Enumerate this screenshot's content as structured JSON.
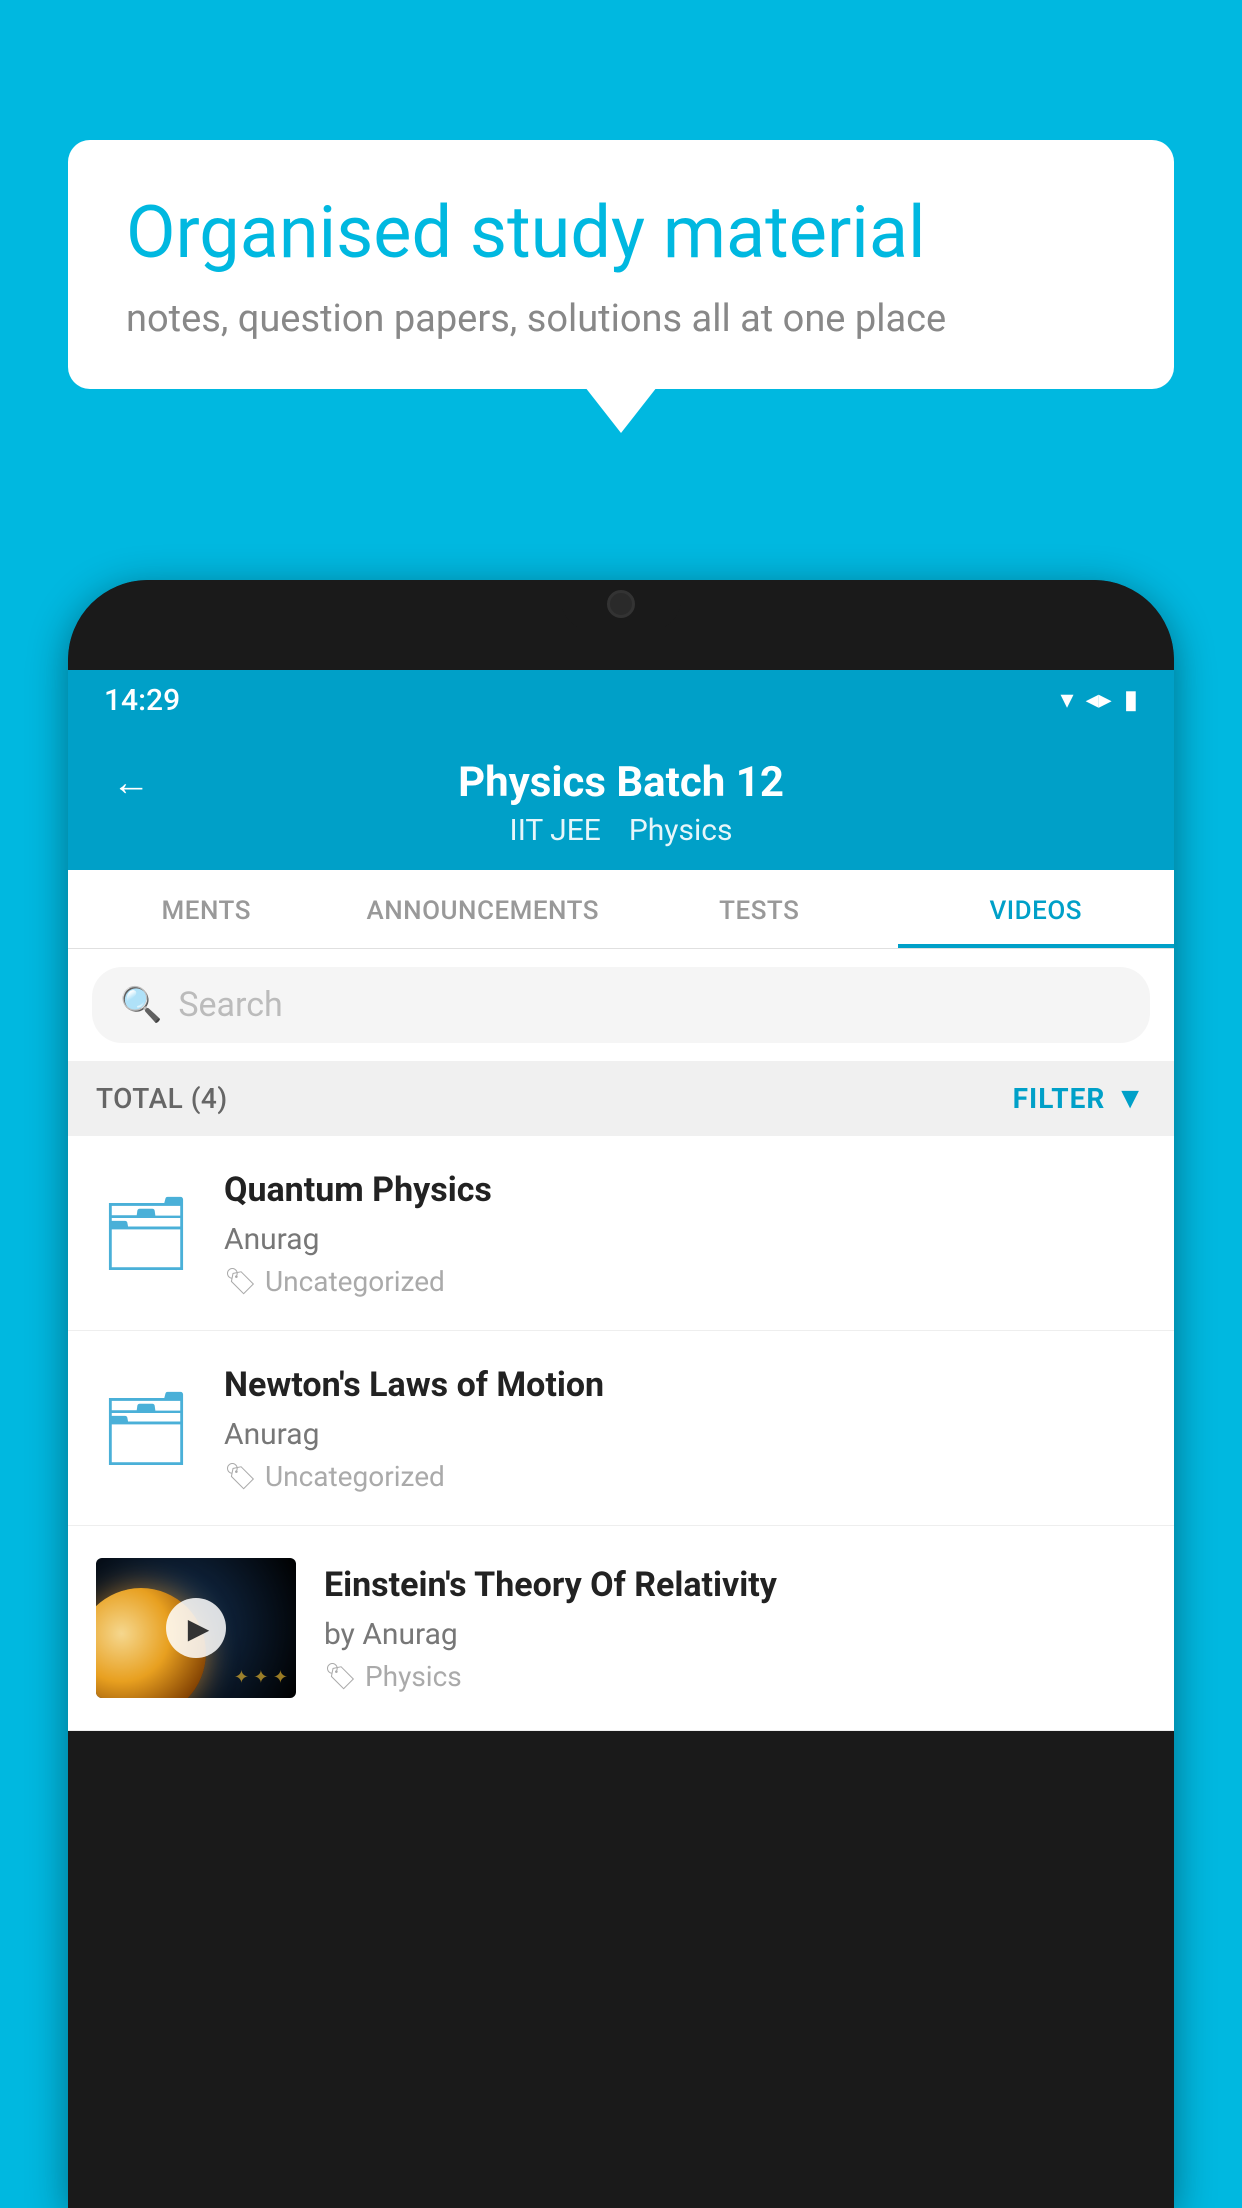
{
  "background_color": "#00b8e0",
  "speech_bubble": {
    "title": "Organised study material",
    "subtitle": "notes, question papers, solutions all at one place"
  },
  "status_bar": {
    "time": "14:29",
    "icons": [
      "wifi",
      "signal",
      "battery"
    ]
  },
  "app_bar": {
    "title": "Physics Batch 12",
    "subtitle1": "IIT JEE",
    "subtitle2": "Physics",
    "back_label": "←"
  },
  "tabs": [
    {
      "label": "MENTS",
      "active": false
    },
    {
      "label": "ANNOUNCEMENTS",
      "active": false
    },
    {
      "label": "TESTS",
      "active": false
    },
    {
      "label": "VIDEOS",
      "active": true
    }
  ],
  "search": {
    "placeholder": "Search"
  },
  "filter_bar": {
    "total_label": "TOTAL (4)",
    "filter_label": "FILTER"
  },
  "videos": [
    {
      "id": 1,
      "title": "Quantum Physics",
      "author": "Anurag",
      "tag": "Uncategorized",
      "has_thumbnail": false
    },
    {
      "id": 2,
      "title": "Newton's Laws of Motion",
      "author": "Anurag",
      "tag": "Uncategorized",
      "has_thumbnail": false
    },
    {
      "id": 3,
      "title": "Einstein's Theory Of Relativity",
      "author": "by Anurag",
      "tag": "Physics",
      "has_thumbnail": true
    }
  ]
}
